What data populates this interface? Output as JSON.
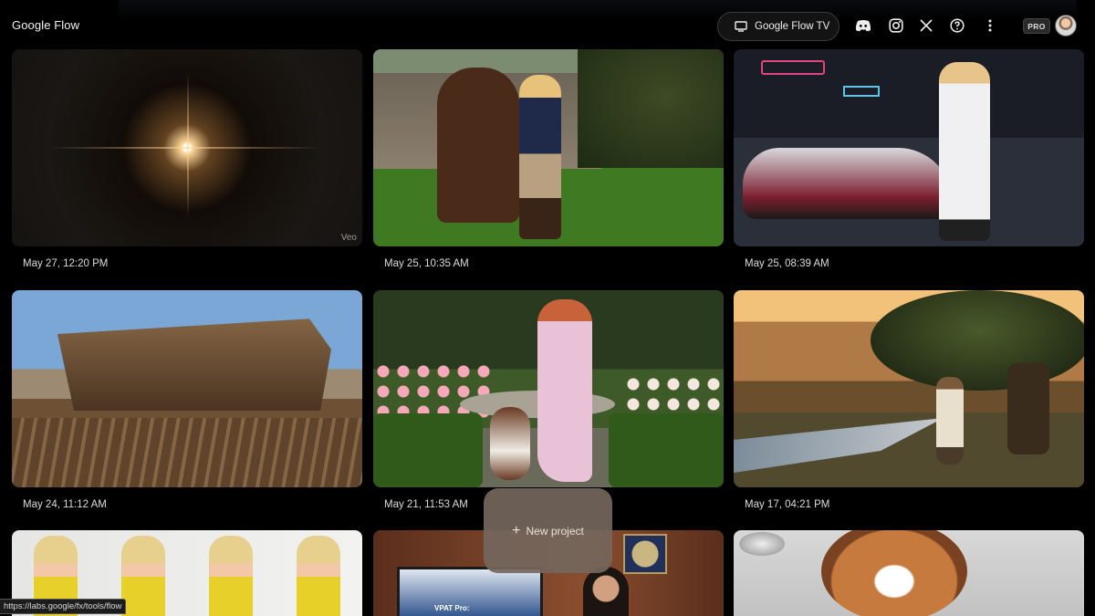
{
  "header": {
    "app_title": "Google Flow",
    "tv_button_label": "Google Flow TV",
    "icons": [
      "monitor-icon",
      "discord-icon",
      "instagram-icon",
      "x-icon",
      "help-icon",
      "more-vert-icon"
    ],
    "plan_badge": "PRO"
  },
  "projects": [
    {
      "date": "May 27, 12:20 PM",
      "badge": "Veo",
      "thumbnail": "light-flare-on-dark"
    },
    {
      "date": "May 25, 10:35 AM",
      "thumbnail": "woman-with-horse-at-stable"
    },
    {
      "date": "May 25, 08:39 AM",
      "thumbnail": "racing-driver-with-formula-car"
    },
    {
      "date": "May 24, 11:12 AM",
      "thumbnail": "wooden-ark-construction"
    },
    {
      "date": "May 21, 11:53 AM",
      "thumbnail": "woman-and-dog-in-rose-garden"
    },
    {
      "date": "May 17, 04:21 PM",
      "thumbnail": "man-by-river-at-sunset"
    },
    {
      "date": "",
      "thumbnail": "woman-in-yellow-dress-turnaround"
    },
    {
      "date": "",
      "thumbnail": "office-with-monitor",
      "overlay_text": "VPAT Pro:"
    },
    {
      "date": "",
      "thumbnail": "smiling-dog-closeup"
    }
  ],
  "new_project": {
    "label": "New project"
  },
  "status_bar": {
    "url": "https://labs.google/fx/tools/flow"
  },
  "colors": {
    "background": "#000000",
    "new_project_bg": "#74665c"
  }
}
